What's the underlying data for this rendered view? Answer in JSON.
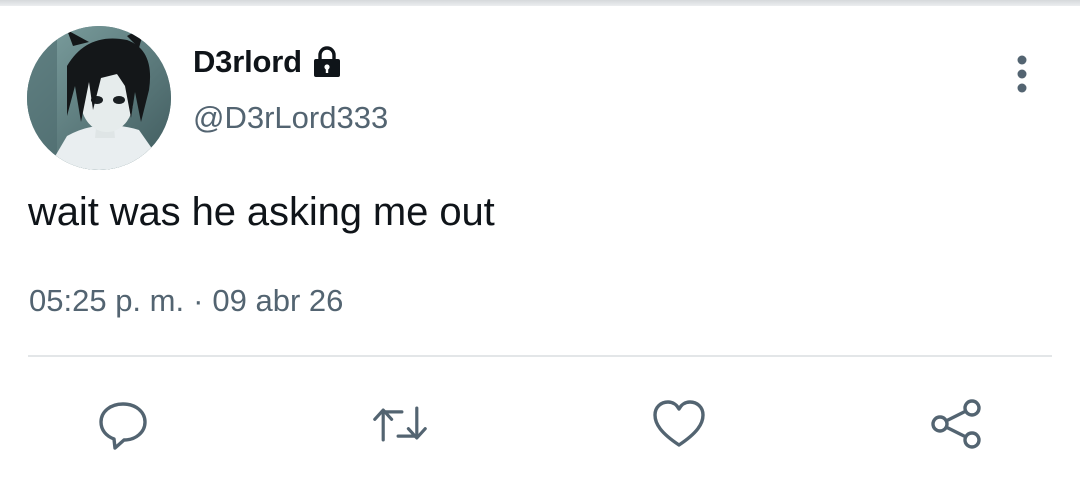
{
  "tweet": {
    "author": {
      "display_name": "D3rlord",
      "handle": "@D3rLord333",
      "protected_icon": "lock-icon",
      "avatar": "profile-avatar"
    },
    "text": "wait was he asking me out",
    "time": "05:25 p. m.",
    "separator": "·",
    "date": "09 abr 26"
  },
  "menu": {
    "icon": "more-vertical-icon"
  },
  "actions": [
    {
      "name": "reply",
      "icon": "comment-icon"
    },
    {
      "name": "retweet",
      "icon": "retweet-icon"
    },
    {
      "name": "like",
      "icon": "heart-icon"
    },
    {
      "name": "share",
      "icon": "share-icon"
    }
  ],
  "colors": {
    "text_primary": "#0f1419",
    "text_secondary": "#536471",
    "icon": "#536471",
    "divider": "#e3e6e8",
    "background": "#ffffff"
  }
}
